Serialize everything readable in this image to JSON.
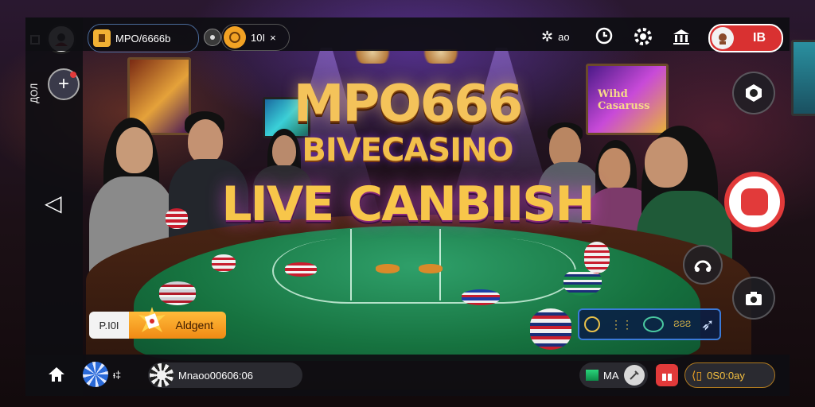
{
  "background": {
    "title_line1": "MPO666",
    "title_line2": "BIVECASINO",
    "title_line3": "LIVE CANBIISH",
    "wall_screen_text": "Wihd Casaruss"
  },
  "topbar": {
    "account_label": "MPO/6666b",
    "chip_count": "10I",
    "close_glyph": "×",
    "settings_label": "ao",
    "notification_badge": "IB"
  },
  "leftrail": {
    "side_label": "ДОЛ",
    "back_glyph": "◁"
  },
  "bet_panel": {
    "amount": "P.I0I",
    "action_label": "Aldgent"
  },
  "info_panel": {
    "label": "ƧƧƧ"
  },
  "bottombar": {
    "coin_count": "ᵻ‡",
    "username": "Mnaoo00606:06",
    "balance_label": "MA",
    "credit_label": "0S0:0ay"
  },
  "colors": {
    "accent_gold": "#f5a623",
    "record_red": "#e23a3a",
    "bar_bg": "#0e0e12"
  }
}
